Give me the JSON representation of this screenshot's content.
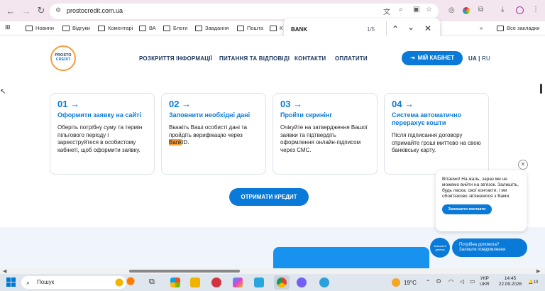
{
  "browser": {
    "url": "prostocredit.com.ua",
    "bookmarks": [
      "Новини",
      "Відгуки",
      "Коментарі",
      "ВА",
      "Блоги",
      "Завдання",
      "Пошта",
      "К"
    ],
    "all_bookmarks": "Все закладки"
  },
  "find_bar": {
    "query": "BANK",
    "count": "1/5"
  },
  "site": {
    "logo_line1": "PROSTO",
    "logo_line2": "CREDIT",
    "nav": [
      "РОЗКРИТТЯ ІНФОРМАЦІЇ",
      "ПИТАННЯ ТА ВІДПОВІДІ",
      "КОНТАКТИ",
      "ОПЛАТИТИ"
    ],
    "cabinet_label": "МІЙ КАБІНЕТ",
    "lang_ua": "UA",
    "lang_sep": "|",
    "lang_ru": "RU",
    "steps": [
      {
        "num": "01 →",
        "title": "Оформити заявку на сайті",
        "desc": "Оберіть потрібну суму та термін пільгового періоду і зареєструйтеся в особистому кабінеті, щоб оформити заявку."
      },
      {
        "num": "02 →",
        "title": "Заповнити необхідні дані",
        "desc_pre": "Вкажіть Ваші особисті дані та пройдіть верифікацію через ",
        "desc_hl": "Bank",
        "desc_post": "ID."
      },
      {
        "num": "03 →",
        "title": "Пройти скринінг",
        "desc": "Очікуйте на затвердження Вашої заявки та підтвердіть оформлення онлайн-підписом через СМС."
      },
      {
        "num": "04 →",
        "title": "Система автоматично перерахує кошти",
        "desc": "Після підписання договору отримайте гроші миттєво на свою банківську карту."
      }
    ],
    "cta": "ОТРИМАТИ КРЕДИТ"
  },
  "chat": {
    "message": "Вітаємо! На жаль, зараз ми не можемо вийти на зв'язок. Залишіть, будь ласка, свої контакти, і ми обов'язково зв'яжемося з Вами.",
    "button": "Залишити контакти",
    "help_line1": "Потрібна допомога?",
    "help_line2": "Залиште повідомлення",
    "callback": "Замовити дзвінок"
  },
  "taskbar": {
    "search": "Пошук",
    "weather": "19°C",
    "lang1": "УКР",
    "lang2": "UKR",
    "time": "14:45",
    "date": "22.09.2026",
    "notif": "10"
  },
  "colors": {
    "brand_blue": "#0a7ad8",
    "highlight": "#f59f3b"
  }
}
